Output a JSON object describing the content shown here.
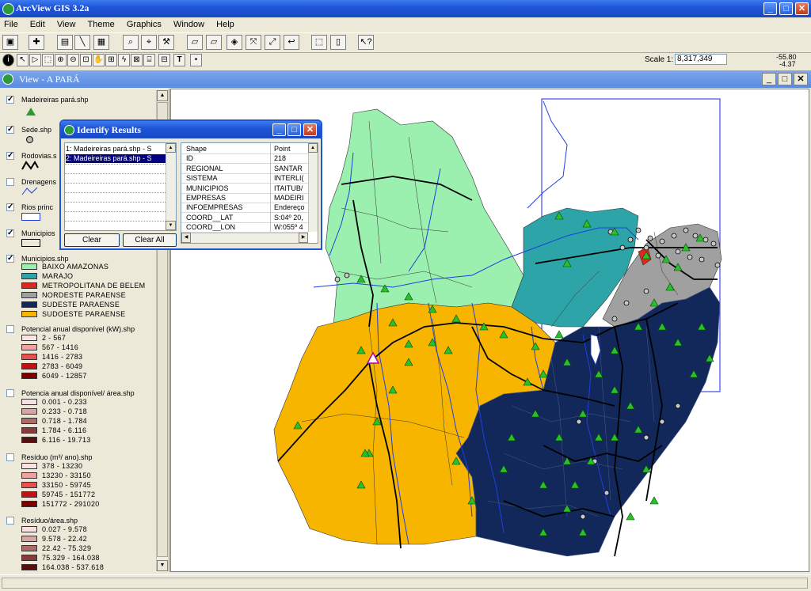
{
  "app": {
    "title": "ArcView GIS 3.2a"
  },
  "menu": [
    "File",
    "Edit",
    "View",
    "Theme",
    "Graphics",
    "Window",
    "Help"
  ],
  "scale": {
    "label": "Scale 1:",
    "value": "8,317,349",
    "coord_x": "-55.80",
    "coord_y": "-4.37"
  },
  "view": {
    "title": "View - A PARÁ"
  },
  "legend": {
    "themes": [
      {
        "label": "Madeireiras pará.shp",
        "checked": true
      },
      {
        "label": "Sede.shp",
        "checked": true
      },
      {
        "label": "Rodovias.s",
        "checked": true
      },
      {
        "label": "Drenagens",
        "checked": false
      },
      {
        "label": "Rios princ",
        "checked": true
      },
      {
        "label": "Municipios",
        "checked": true
      },
      {
        "label": "Municipios.shp",
        "checked": true
      },
      {
        "label": "Potencial anual disponível (kW).shp",
        "checked": false
      },
      {
        "label": "Potencia anual disponível/ área.shp",
        "checked": false
      },
      {
        "label": "Resíduo (m³/ ano).shp",
        "checked": false
      },
      {
        "label": "Resíduo/área.shp",
        "checked": false
      }
    ],
    "regions": [
      {
        "label": "BAIXO AMAZONAS",
        "color": "#9bf0b0"
      },
      {
        "label": "MARAJO",
        "color": "#2ca4a8"
      },
      {
        "label": "METROPOLITANA DE BELEM",
        "color": "#e0261e"
      },
      {
        "label": "NORDESTE PARAENSE",
        "color": "#a0a0a0"
      },
      {
        "label": "SUDESTE PARAENSE",
        "color": "#13285a"
      },
      {
        "label": "SUDOESTE PARAENSE",
        "color": "#f7b500"
      }
    ],
    "potencial": [
      "2 - 567",
      "567 - 1416",
      "1416 - 2783",
      "2783 - 6049",
      "6049 - 12857"
    ],
    "potencia_area": [
      "0.001 - 0.233",
      "0.233 - 0.718",
      "0.718 - 1.784",
      "1.784 - 6.116",
      "6.116 - 19.713"
    ],
    "residuo": [
      "378 - 13230",
      "13230 - 33150",
      "33150 - 59745",
      "59745 - 151772",
      "151772 - 291020"
    ],
    "residuo_area": [
      "0.027 - 9.578",
      "9.578 - 22.42",
      "22.42 - 75.329",
      "75.329 - 164.038",
      "164.038 - 537.618"
    ],
    "ramp_red": [
      "#fbe3e3",
      "#f2a0a0",
      "#e85050",
      "#c41010",
      "#7a0000"
    ],
    "ramp_brown": [
      "#f8e0e0",
      "#d8a4a4",
      "#b06a6a",
      "#8a3a3a",
      "#5a0f0f"
    ]
  },
  "identify": {
    "title": "Identify Results",
    "items": [
      "1:  Madeireiras pará.shp - S",
      "2:  Madeireiras pará.shp - S"
    ],
    "fields": [
      [
        "Shape",
        "Point"
      ],
      [
        "ID",
        "218"
      ],
      [
        "REGIONAL",
        "SANTAR"
      ],
      [
        "SISTEMA",
        "INTERLI("
      ],
      [
        "MUNICIPIOS",
        "ITAITUB/"
      ],
      [
        "EMPRESAS",
        "MADEIRI"
      ],
      [
        "INFOEMPRESAS",
        "Endereço"
      ],
      [
        "COORD__LAT",
        "S:04º 20,"
      ],
      [
        "COORD__LON",
        "W:055º 4"
      ]
    ],
    "clear": "Clear",
    "clear_all": "Clear All"
  }
}
